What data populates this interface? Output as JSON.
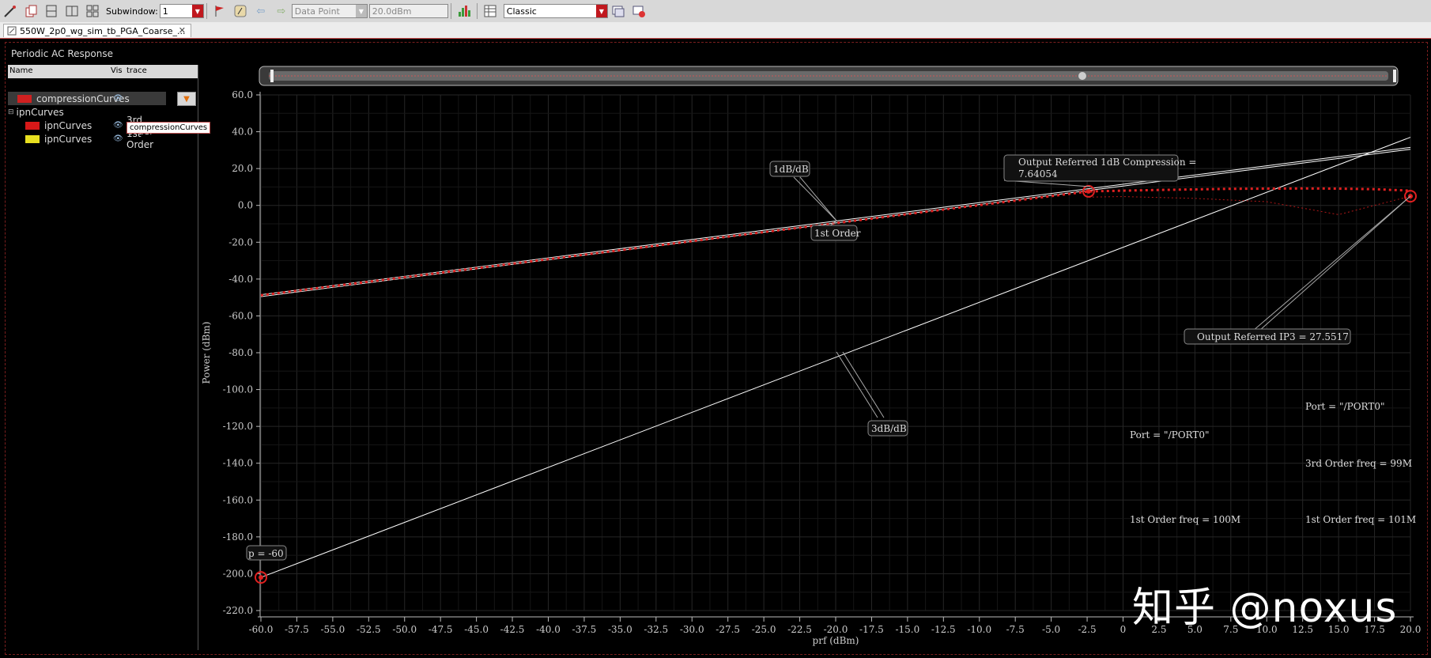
{
  "toolbar": {
    "subwindow_label": "Subwindow:",
    "subwindow_value": "1",
    "data_point_value": "Data Point",
    "level_value": "20.0dBm",
    "style_value": "Classic"
  },
  "tab": {
    "label": "550W_2p0_wg_sim_tb_PGA_Coarse_..."
  },
  "window_title": "Periodic AC Response",
  "panel": {
    "columns": [
      "Name",
      "Vis",
      "trace"
    ],
    "rows": [
      {
        "name": "compressionCurves",
        "trace": "",
        "color": "#d02020",
        "level": 0
      },
      {
        "name": "ipnCurves",
        "trace": "",
        "color": null,
        "level": 0
      },
      {
        "name": "ipnCurves",
        "trace": "3rd Order",
        "color": "#d81818",
        "level": 1
      },
      {
        "name": "ipnCurves",
        "trace": "1st Order",
        "color": "#e8e020",
        "level": 1
      }
    ],
    "tooltip": "compressionCurves"
  },
  "annotations": {
    "slope_1db": "1dB/dB",
    "first_order": "1st Order",
    "slope_3db": "3dB/dB",
    "compression_line1": "Output Referred 1dB Compression =",
    "compression_line2": "7.64054",
    "ip3": "Output Referred IP3 = 27.5517",
    "p_marker": "p = -60",
    "port1": "Port = \"/PORT0\"",
    "port2": "Port = \"/PORT0\"",
    "third_order_freq": "3rd Order freq = 99M",
    "first_order_freq1": "1st Order freq = 100M",
    "first_order_freq2": "1st Order freq = 101M"
  },
  "watermark": "知乎 @noxus",
  "colors": {
    "accent": "#c0181e",
    "trace_1st": "#ffffff",
    "trace_compression": "#e02020",
    "marker": "#e02020"
  },
  "chart_data": {
    "type": "line",
    "xlabel": "prf (dBm)",
    "ylabel": "Power (dBm)",
    "xlim": [
      -60,
      20
    ],
    "ylim": [
      -220,
      60
    ],
    "x_ticks": [
      "-60.0",
      "-57.5",
      "-55.0",
      "-52.5",
      "-50.0",
      "-47.5",
      "-45.0",
      "-42.5",
      "-40.0",
      "-37.5",
      "-35.0",
      "-32.5",
      "-30.0",
      "-27.5",
      "-25.0",
      "-22.5",
      "-20.0",
      "-17.5",
      "-15.0",
      "-12.5",
      "-10.0",
      "-7.5",
      "-5.0",
      "-2.5",
      "0",
      "2.5",
      "5.0",
      "7.5",
      "10.0",
      "12.5",
      "15.0",
      "17.5",
      "20.0"
    ],
    "y_ticks": [
      "60.0",
      "40.0",
      "20.0",
      "0.0",
      "-20.0",
      "-40.0",
      "-60.0",
      "-80.0",
      "-100.0",
      "-120.0",
      "-140.0",
      "-160.0",
      "-180.0",
      "-200.0",
      "-220.0"
    ],
    "grid": true,
    "series": [
      {
        "x": [
          -60,
          20
        ],
        "y": [
          -49.5,
          30.5
        ],
        "color": "#ffffff"
      },
      {
        "x": [
          -60,
          20
        ],
        "y": [
          -48.5,
          31.5
        ],
        "color": "#ffffff"
      },
      {
        "x": [
          -60,
          20
        ],
        "y": [
          -202,
          37
        ],
        "color": "#ffffff"
      },
      {
        "x": [
          -60,
          -2.4,
          2.5,
          7.5,
          12.5,
          15,
          17.5,
          20
        ],
        "y": [
          -48.8,
          7.6,
          8.4,
          9.0,
          9.2,
          9.1,
          8.8,
          8.0
        ],
        "color": "#e02020",
        "dash": true
      },
      {
        "x": [
          -2.4,
          0,
          5,
          10,
          15,
          20
        ],
        "y": [
          4.5,
          4.8,
          3.8,
          2.0,
          -5.0,
          5.0
        ],
        "color": "#b01818",
        "dash": true
      }
    ],
    "markers": [
      {
        "x": -60,
        "y": -202
      },
      {
        "x": -2.4,
        "y": 7.64
      },
      {
        "x": 20,
        "y": 5.0
      }
    ]
  }
}
